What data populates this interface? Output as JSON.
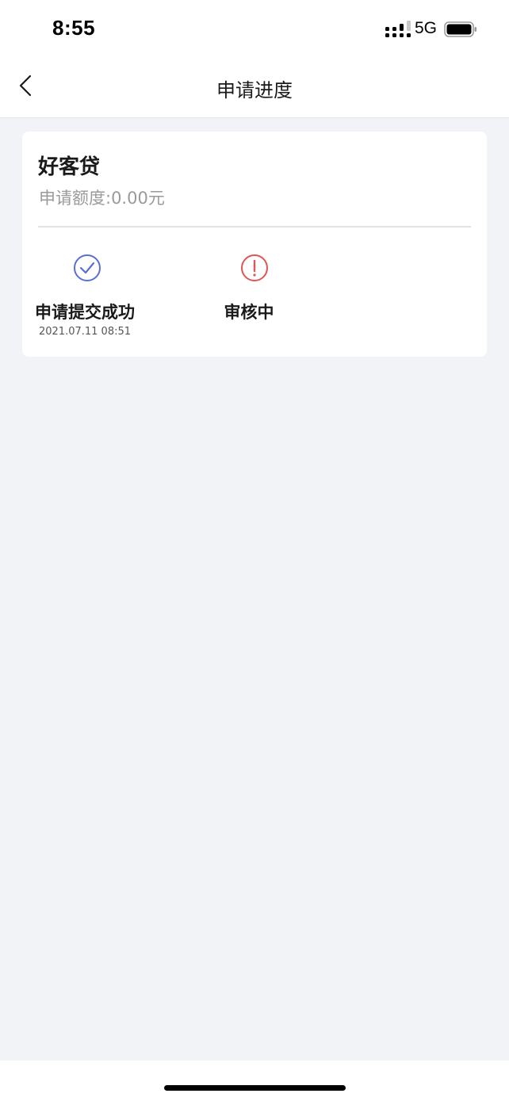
{
  "status_bar": {
    "time": "8:55",
    "network": "5G"
  },
  "nav": {
    "title": "申请进度",
    "back_icon": "chevron-left-icon"
  },
  "card": {
    "product_name": "好客贷",
    "amount_text": "申请额度:0.00元",
    "steps": [
      {
        "label": "申请提交成功",
        "time": "2021.07.11 08:51",
        "status": "done",
        "icon": "check-circle-icon",
        "color": "#5b6ed6"
      },
      {
        "label": "审核中",
        "time": "",
        "status": "pending",
        "icon": "alert-circle-icon",
        "color": "#e05555"
      }
    ]
  },
  "colors": {
    "background": "#f2f3f7",
    "done": "#5b6ed6",
    "pending": "#e05555"
  }
}
